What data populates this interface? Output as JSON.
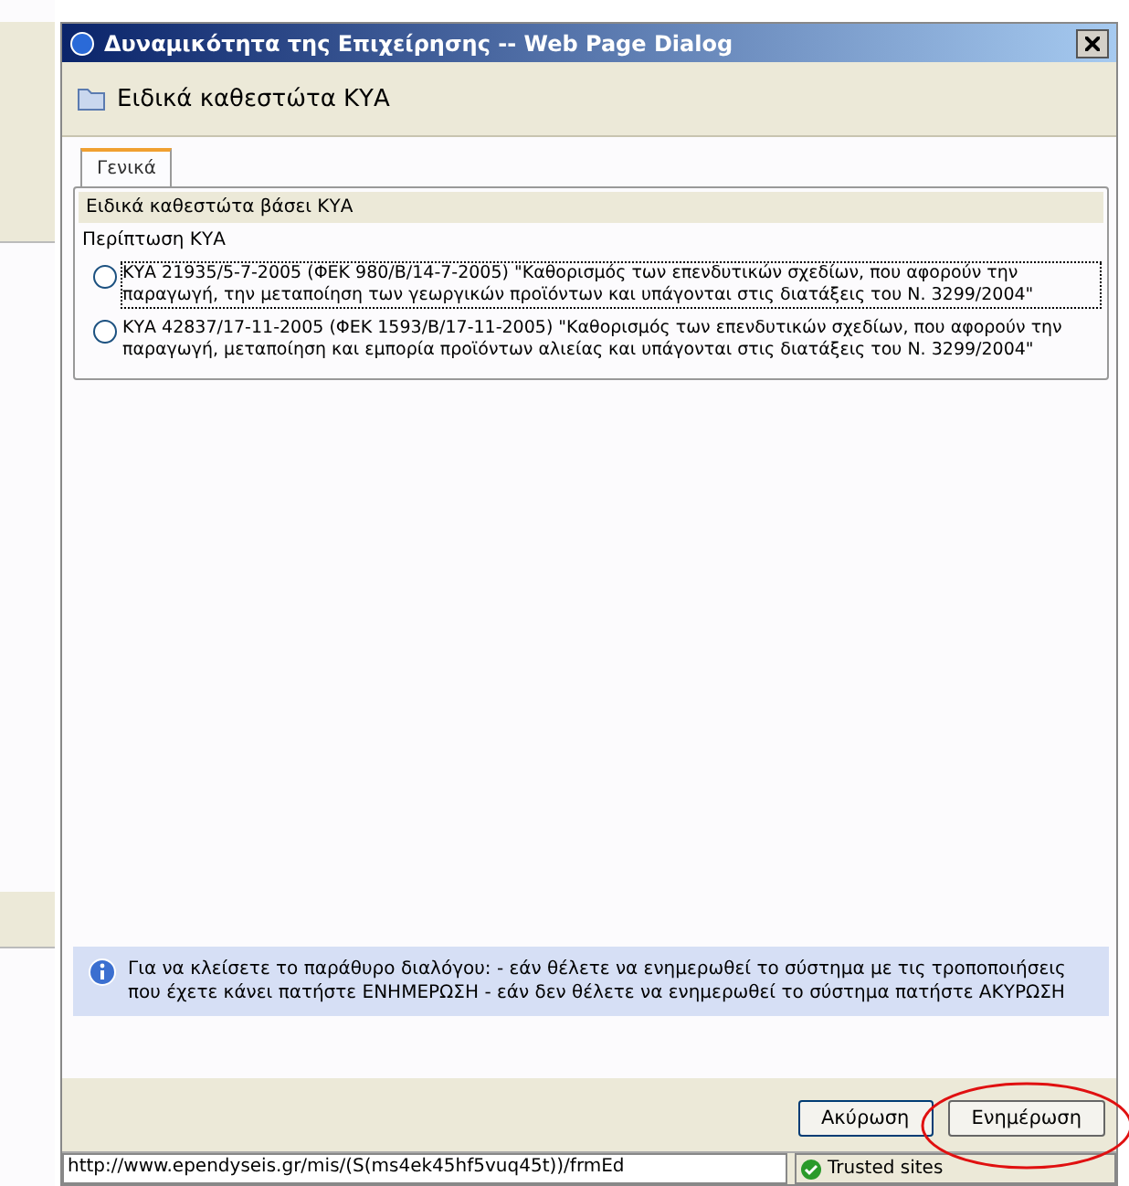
{
  "window": {
    "title": "Δυναμικότητα της Επιχείρησης -- Web Page Dialog"
  },
  "header": {
    "title": "Ειδικά καθεστώτα ΚΥΑ"
  },
  "tabs": [
    {
      "label": "Γενικά",
      "selected": true
    }
  ],
  "group": {
    "title": "Ειδικά καθεστώτα βάσει ΚΥΑ",
    "label": "Περίπτωση ΚΥΑ",
    "options": [
      {
        "text": "ΚΥΑ 21935/5-7-2005 (ΦΕΚ 980/Β/14-7-2005) \"Καθορισμός των επενδυτικών σχεδίων, που αφορούν την παραγωγή, την μεταποίηση των γεωργικών προϊόντων και υπάγονται στις διατάξεις του Ν. 3299/2004\"",
        "selected": false,
        "focused": true
      },
      {
        "text": "ΚΥΑ 42837/17-11-2005 (ΦΕΚ 1593/Β/17-11-2005) \"Καθορισμός των επενδυτικών σχεδίων, που αφορούν την παραγωγή, μεταποίηση και εμπορία προϊόντων αλιείας και υπάγονται στις διατάξεις του Ν. 3299/2004\"",
        "selected": false,
        "focused": false
      }
    ]
  },
  "info": {
    "text": "Για να κλείσετε το παράθυρο διαλόγου: - εάν θέλετε να ενημερωθεί το σύστημα με τις τροποποιήσεις που έχετε κάνει πατήστε ΕΝΗΜΕΡΩΣΗ - εάν δεν θέλετε να ενημερωθεί το σύστημα πατήστε ΑΚΥΡΩΣΗ"
  },
  "buttons": [
    {
      "label": "Ακύρωση",
      "highlighted": false
    },
    {
      "label": "Ενημέρωση",
      "highlighted": true
    }
  ],
  "status_bar": {
    "url": "http://www.ependyseis.gr/mis/(S(ms4ek45hf5vuq45t))/frmEd",
    "zone": "Trusted sites"
  }
}
